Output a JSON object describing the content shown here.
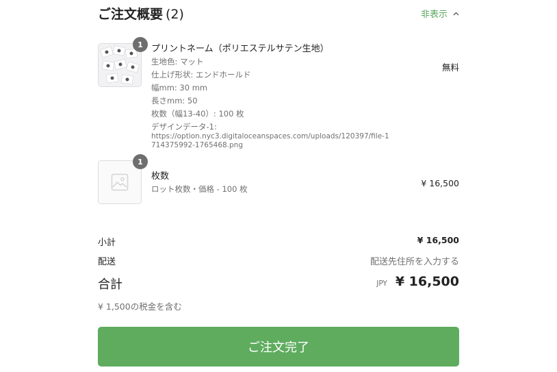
{
  "summary": {
    "title": "ご注文概要",
    "count": "(2)",
    "toggle_label": "非表示"
  },
  "items": [
    {
      "quantity": "1",
      "name": "プリントネーム（ポリエステルサテン生地）",
      "options": [
        "生地色: マット",
        "仕上げ形状: エンドホールド",
        "幅mm: 30 mm",
        "長さmm: 50",
        "枚数（幅13-40）: 100 枚",
        "デザインデータ-1:"
      ],
      "url": "https://option.nyc3.digitaloceanspaces.com/uploads/120397/file-1714375992-1765468.png",
      "price": "無料"
    },
    {
      "quantity": "1",
      "name": "枚数",
      "options": [
        "ロット枚数・価格 - 100 枚"
      ],
      "price": "¥ 16,500"
    }
  ],
  "totals": {
    "subtotal_label": "小計",
    "subtotal_value": "¥ 16,500",
    "shipping_label": "配送",
    "shipping_value": "配送先住所を入力する",
    "total_label": "合計",
    "currency": "JPY",
    "total_value": "¥ 16,500",
    "tax_note": "¥ 1,500の税金を含む"
  },
  "buttons": {
    "complete_label": "ご注文完了"
  },
  "colors": {
    "accent": "#5aa55e",
    "button": "#5fac5f",
    "badge": "#6e6e6e"
  }
}
